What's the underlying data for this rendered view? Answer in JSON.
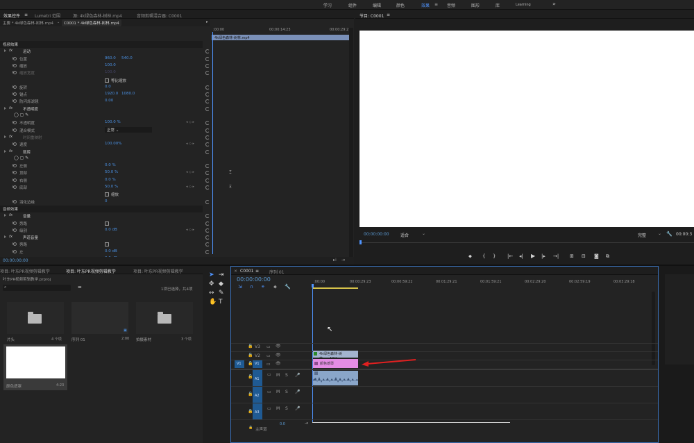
{
  "workspaces": [
    "学习",
    "组件",
    "编辑",
    "颜色",
    "效果",
    "音频",
    "图形",
    "库",
    "Learning"
  ],
  "active_workspace": "效果",
  "workspace_more": "»",
  "ec_tabs": {
    "effect_controls": "效果控件",
    "lumetri": "Lumetri 范围",
    "source": "源: 4k绿色森林-树林.mp4",
    "audio_mixer": "音频剪辑混合器: C0001"
  },
  "ec_header": {
    "master": "主要 * 4k绿色森林-树林.mp4",
    "seq": "C0001 * 4k绿色森林-树林.mp4",
    "tc_start": ":00:00",
    "tc_mid": "00:00:14:23",
    "tc_end": "00:00:29:2",
    "clip_bar": "4k绿色森林-树林.mp4"
  },
  "ec_rows": [
    {
      "label": "视频效果",
      "indent": 0,
      "section": true
    },
    {
      "label": "运动",
      "indent": 1,
      "fx": true
    },
    {
      "label": "位置",
      "indent": 2,
      "v1": "960.0",
      "v2": "540.0"
    },
    {
      "label": "缩放",
      "indent": 2,
      "v1": "100.0"
    },
    {
      "label": "缩放宽度",
      "indent": 2,
      "v1": "100.0",
      "dim": true
    },
    {
      "label": "",
      "indent": 2,
      "check": "等比缩放"
    },
    {
      "label": "旋转",
      "indent": 2,
      "v1": "0.0"
    },
    {
      "label": "锚点",
      "indent": 2,
      "v1": "1920.0",
      "v2": "1080.0"
    },
    {
      "label": "防闪烁滤镜",
      "indent": 2,
      "v1": "0.00"
    },
    {
      "label": "不透明度",
      "indent": 1,
      "fx": true
    },
    {
      "label": "",
      "indent": 2,
      "shapes": true
    },
    {
      "label": "不透明度",
      "indent": 2,
      "v1": "100.0 %",
      "kf": true
    },
    {
      "label": "混合模式",
      "indent": 2,
      "select": "正常"
    },
    {
      "label": "时间重映射",
      "indent": 1,
      "fx": true,
      "dim": true
    },
    {
      "label": "速度",
      "indent": 2,
      "v1": "100.00%",
      "kf": true
    },
    {
      "label": "裁剪",
      "indent": 1,
      "fx": true
    },
    {
      "label": "",
      "indent": 2,
      "shapes": true
    },
    {
      "label": "左侧",
      "indent": 2,
      "v1": "0.0 %"
    },
    {
      "label": "顶部",
      "indent": 2,
      "v1": "50.0 %",
      "kf": true
    },
    {
      "label": "右侧",
      "indent": 2,
      "v1": "0.0 %"
    },
    {
      "label": "底部",
      "indent": 2,
      "v1": "50.0 %",
      "kf": true
    },
    {
      "label": "",
      "indent": 2,
      "check": "缩放"
    },
    {
      "label": "羽化边缘",
      "indent": 2,
      "v1": "0"
    },
    {
      "label": "音频效果",
      "indent": 0,
      "section": true
    },
    {
      "label": "音量",
      "indent": 1,
      "fx": true
    },
    {
      "label": "旁路",
      "indent": 2,
      "checkbox": true
    },
    {
      "label": "级别",
      "indent": 2,
      "v1": "0.0 dB",
      "kf": true
    },
    {
      "label": "声道音量",
      "indent": 1,
      "fx": true
    },
    {
      "label": "旁路",
      "indent": 2,
      "checkbox": true
    },
    {
      "label": "左",
      "indent": 2,
      "v1": "0.0 dB"
    },
    {
      "label": "右",
      "indent": 2,
      "v1": "0.0 dB"
    }
  ],
  "ec_footer_tc": "00:00:00:00",
  "program": {
    "tab": "节目: C0001",
    "timecode": "00:00:00:00",
    "fit": "适合",
    "quality": "完整",
    "tc_right": "00:00:3"
  },
  "project": {
    "tabs": [
      "项目: 叶东PR视频剪辑教学",
      "项目: 叶东PR视频剪辑教学",
      "项目: 叶东PR视频剪辑教学"
    ],
    "file": "叶东PR视频剪辑教学.prproj",
    "selection": "1项已选择，共4项",
    "items": [
      {
        "name": "片头",
        "meta": "4 个项"
      },
      {
        "name": "序列 01",
        "meta": "2:00"
      },
      {
        "name": "拍摄素材",
        "meta": "3 个项"
      },
      {
        "name": "颜色遮罩",
        "meta": "4:23"
      }
    ]
  },
  "timeline": {
    "tabs": [
      "C0001",
      "序列 01"
    ],
    "timecode": "00:00:00:00",
    "ruler": [
      ":00:00",
      "00:00:29:23",
      "00:00:59:22",
      "00:01:29:21",
      "00:01:59:21",
      "00:02:29:20",
      "00:02:59:19",
      "00:03:29:18"
    ],
    "video_tracks": [
      "V3",
      "V2",
      "V1"
    ],
    "audio_tracks": [
      "A1",
      "A2",
      "A3"
    ],
    "src_v1": "V1",
    "src_a1": "A1",
    "master": "主声道",
    "master_val": "0.0",
    "clip_video": "4k绿色森林-树林.mp4[V]",
    "clip_matte": "颜色遮罩",
    "track_btn_m": "M",
    "track_btn_s": "S"
  },
  "colors": {
    "accent": "#4f94ff",
    "timecode": "#4a90e2",
    "matte_clip": "#e48de4",
    "video_clip": "#a3b3cf",
    "audio_clip": "#8aa6c9",
    "arrow": "#e02020"
  }
}
